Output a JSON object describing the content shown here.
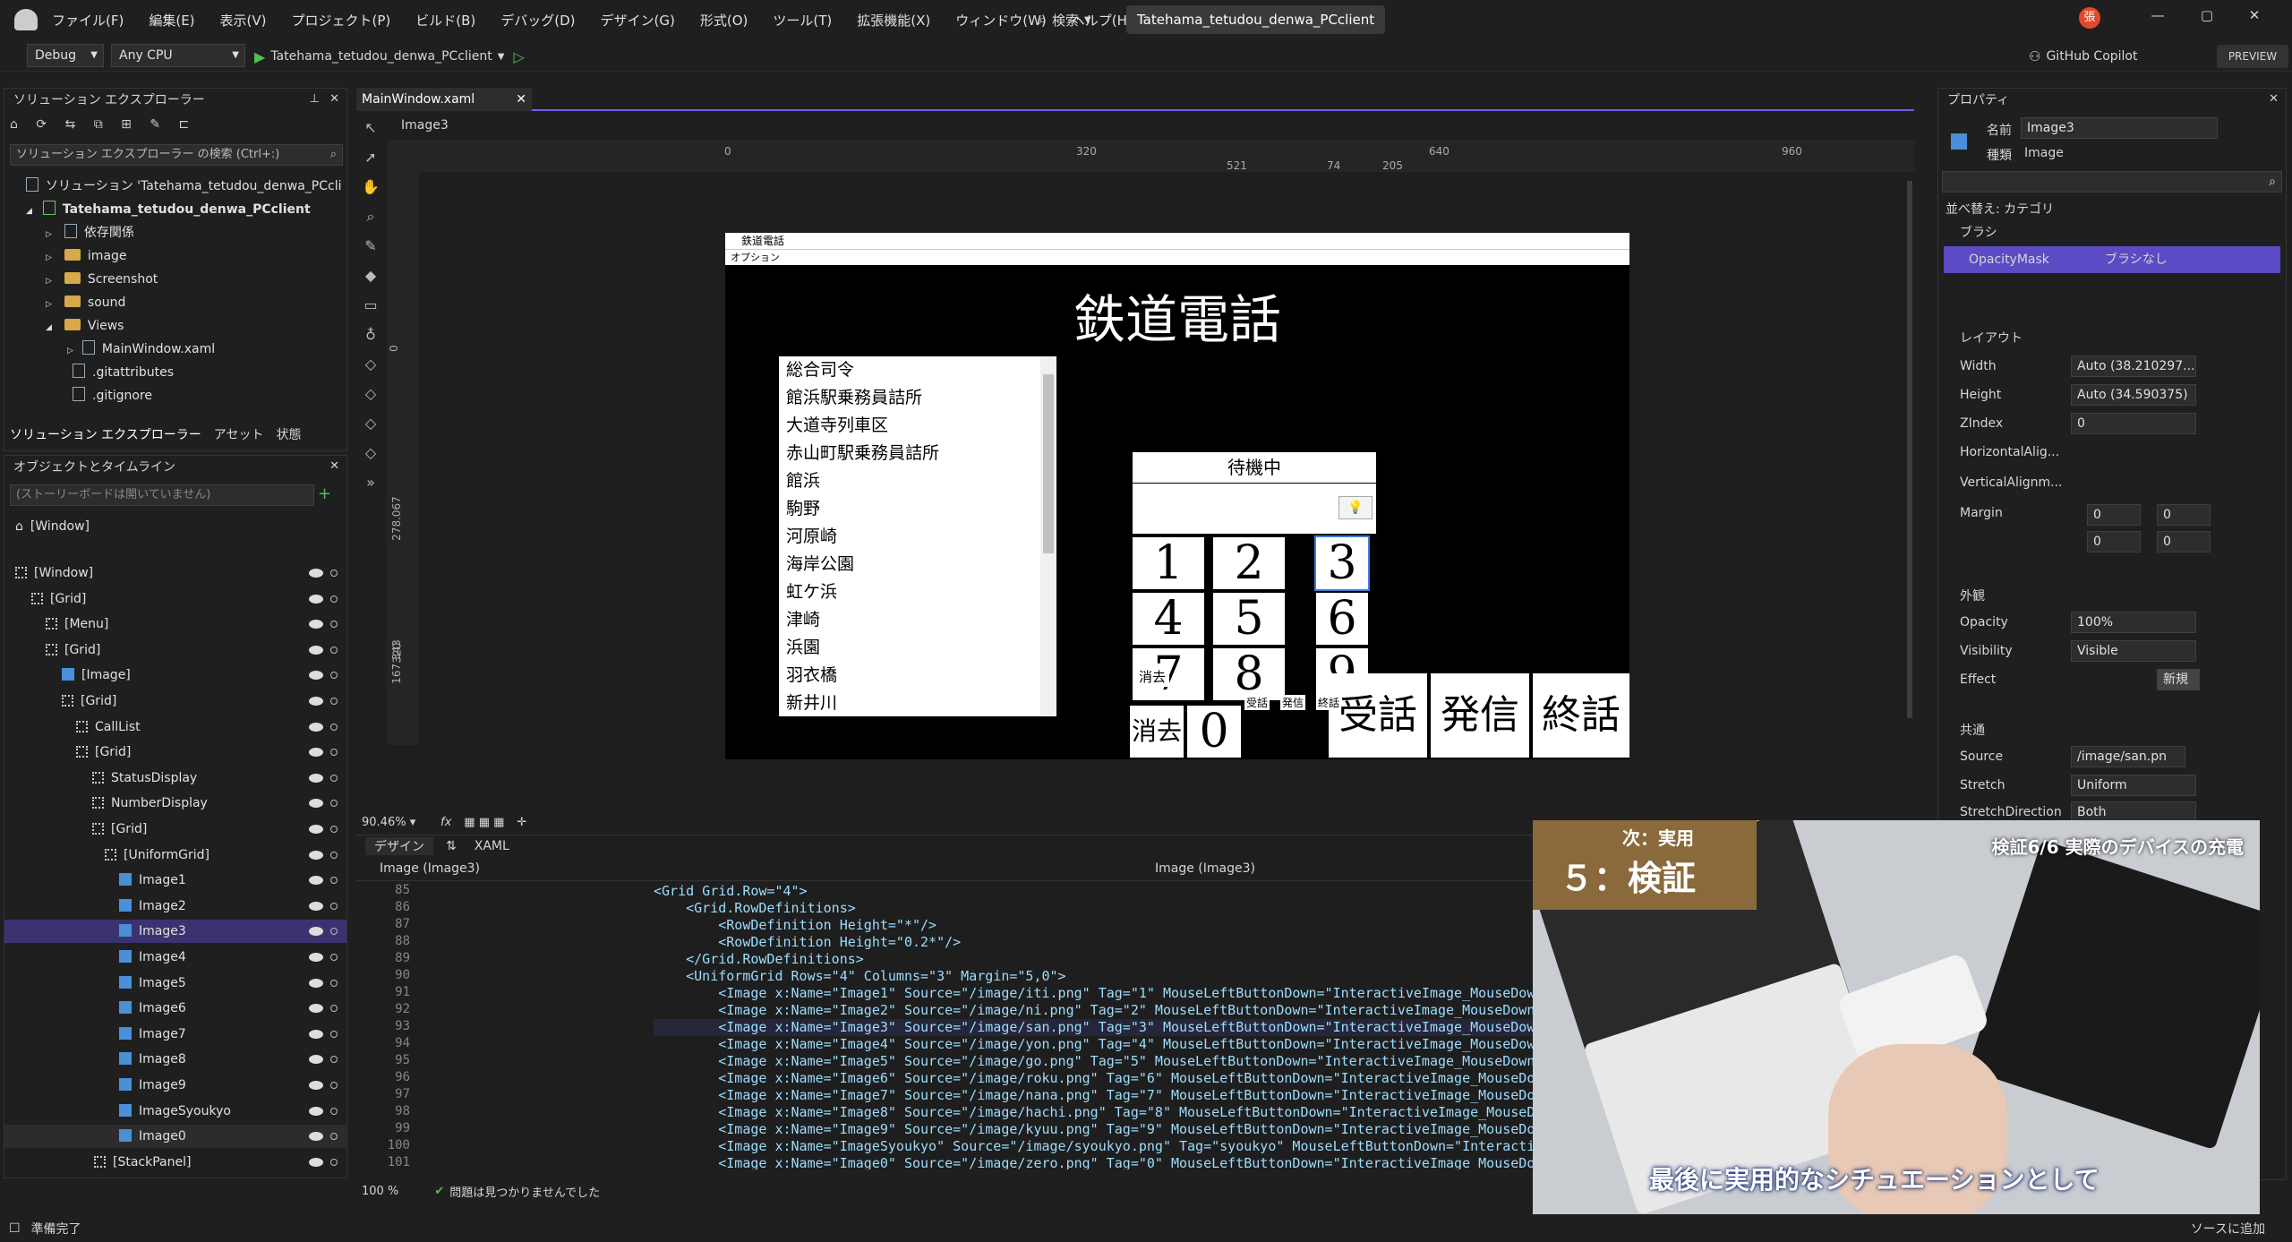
{
  "menubar": {
    "items": [
      "ファイル(F)",
      "編集(E)",
      "表示(V)",
      "プロジェクト(P)",
      "ビルド(B)",
      "デバッグ(D)",
      "デザイン(G)",
      "形式(O)",
      "ツール(T)",
      "拡張機能(X)",
      "ウィンドウ(W)",
      "ヘルプ(H)"
    ],
    "search": "検索",
    "solution_name": "Tatehama_tetudou_denwa_PCclient",
    "avatar": "張",
    "copilot": "GitHub Copilot",
    "preview": "PREVIEW"
  },
  "toolbar": {
    "config": "Debug",
    "platform": "Any CPU",
    "run_target": "Tatehama_tetudou_denwa_PCclient"
  },
  "solution_explorer": {
    "title": "ソリューション エクスプローラー",
    "search_placeholder": "ソリューション エクスプローラー の検索 (Ctrl+:)",
    "solution": "ソリューション 'Tatehama_tetudou_denwa_PCcli",
    "project": "Tatehama_tetudou_denwa_PCclient",
    "items": [
      "依存関係",
      "image",
      "Screenshot",
      "sound",
      "Views",
      "MainWindow.xaml",
      ".gitattributes",
      ".gitignore"
    ],
    "tabs": [
      "ソリューション エクスプローラー",
      "アセット",
      "状態"
    ]
  },
  "objects_timeline": {
    "title": "オブジェクトとタイムライン",
    "storyboard_placeholder": "(ストーリーボードは開いていません)",
    "window_label": "[Window]",
    "nodes": [
      "[Window]",
      "[Grid]",
      "[Menu]",
      "[Grid]",
      "[Image]",
      "[Grid]",
      "CallList",
      "[Grid]",
      "StatusDisplay",
      "NumberDisplay",
      "[Grid]",
      "[UniformGrid]",
      "Image1",
      "Image2",
      "Image3",
      "Image4",
      "Image5",
      "Image6",
      "Image7",
      "Image8",
      "Image9",
      "ImageSyoukyo",
      "Image0",
      "[StackPanel]"
    ]
  },
  "editor": {
    "tab": "MainWindow.xaml",
    "breadcrumb": "Image3",
    "ruler_top": [
      "0",
      "320",
      "640",
      "960"
    ],
    "ruler_sub": [
      "521",
      "74",
      "205"
    ],
    "ruler_left": [
      "0",
      "278.067",
      "320",
      "167.343"
    ],
    "zoom": "90.46%",
    "design_tab": "デザイン",
    "xaml_tab": "XAML",
    "code_scope_left": "Image (Image3)",
    "code_scope_right": "Image (Image3)",
    "status_zoom": "100 %",
    "status_msg": "問題は見つかりませんでした"
  },
  "app": {
    "window_title": "鉄道電話",
    "menu": "オプション",
    "heading": "鉄道電話",
    "status": "待機中",
    "call_list": [
      "総合司令",
      "館浜駅乗務員詰所",
      "大道寺列車区",
      "赤山町駅乗務員詰所",
      "館浜",
      "駒野",
      "河原崎",
      "海岸公園",
      "虹ケ浜",
      "津崎",
      "浜園",
      "羽衣橋",
      "新井川"
    ],
    "keys": [
      "1",
      "2",
      "3",
      "4",
      "5",
      "6",
      "7",
      "8",
      "9",
      "消去",
      "0"
    ],
    "buttons": [
      "受話",
      "発信",
      "終話"
    ],
    "small_labels": [
      "消去",
      "受話",
      "発信",
      "終話"
    ]
  },
  "code": {
    "lines": [
      {
        "n": "85",
        "t": "<Grid Grid.Row=\"4\">"
      },
      {
        "n": "86",
        "t": "    <Grid.RowDefinitions>"
      },
      {
        "n": "87",
        "t": "        <RowDefinition Height=\"*\"/>"
      },
      {
        "n": "88",
        "t": "        <RowDefinition Height=\"0.2*\"/>"
      },
      {
        "n": "89",
        "t": "    </Grid.RowDefinitions>"
      },
      {
        "n": "90",
        "t": "    <UniformGrid Rows=\"4\" Columns=\"3\" Margin=\"5,0\">"
      },
      {
        "n": "91",
        "t": "        <Image x:Name=\"Image1\" Source=\"/image/iti.png\" Tag=\"1\" MouseLeftButtonDown=\"InteractiveImage_MouseDown"
      },
      {
        "n": "92",
        "t": "        <Image x:Name=\"Image2\" Source=\"/image/ni.png\" Tag=\"2\" MouseLeftButtonDown=\"InteractiveImage_MouseDown"
      },
      {
        "n": "93",
        "t": "        <Image x:Name=\"Image3\" Source=\"/image/san.png\" Tag=\"3\" MouseLeftButtonDown=\"InteractiveImage_MouseDown"
      },
      {
        "n": "94",
        "t": "        <Image x:Name=\"Image4\" Source=\"/image/yon.png\" Tag=\"4\" MouseLeftButtonDown=\"InteractiveImage_MouseDown"
      },
      {
        "n": "95",
        "t": "        <Image x:Name=\"Image5\" Source=\"/image/go.png\" Tag=\"5\" MouseLeftButtonDown=\"InteractiveImage_MouseDown"
      },
      {
        "n": "96",
        "t": "        <Image x:Name=\"Image6\" Source=\"/image/roku.png\" Tag=\"6\" MouseLeftButtonDown=\"InteractiveImage_MouseDo"
      },
      {
        "n": "97",
        "t": "        <Image x:Name=\"Image7\" Source=\"/image/nana.png\" Tag=\"7\" MouseLeftButtonDown=\"InteractiveImage_MouseDo"
      },
      {
        "n": "98",
        "t": "        <Image x:Name=\"Image8\" Source=\"/image/hachi.png\" Tag=\"8\" MouseLeftButtonDown=\"InteractiveImage_MouseDo"
      },
      {
        "n": "99",
        "t": "        <Image x:Name=\"Image9\" Source=\"/image/kyuu.png\" Tag=\"9\" MouseLeftButtonDown=\"InteractiveImage_MouseDo"
      },
      {
        "n": "100",
        "t": "        <Image x:Name=\"ImageSyoukyo\" Source=\"/image/syoukyo.png\" Tag=\"syoukyo\" MouseLeftButtonDown=\"Interacti"
      },
      {
        "n": "101",
        "t": "        <Image x:Name=\"Image0\" Source=\"/image/zero.png\" Tag=\"0\" MouseLeftButtonDown=\"InteractiveImage_MouseDo"
      }
    ]
  },
  "properties": {
    "title": "プロパティ",
    "name_label": "名前",
    "name_value": "Image3",
    "type_label": "種類",
    "type_value": "Image",
    "sort": "並べ替え: カテゴリ",
    "brush_section": "ブラシ",
    "opacity_mask": "OpacityMask",
    "no_brush": "ブラシなし",
    "layout_section": "レイアウト",
    "width_label": "Width",
    "width_value": "Auto (38.210297...",
    "height_label": "Height",
    "height_value": "Auto (34.590375)",
    "zindex_label": "ZIndex",
    "zindex_value": "0",
    "halign_label": "HorizontalAlig...",
    "valign_label": "VerticalAlignm...",
    "margin_label": "Margin",
    "margin_values": [
      "0",
      "0",
      "0",
      "0"
    ],
    "appearance_section": "外観",
    "opacity_label": "Opacity",
    "opacity_value": "100%",
    "visibility_label": "Visibility",
    "visibility_value": "Visible",
    "effect_label": "Effect",
    "effect_button": "新規",
    "common_section": "共通",
    "source_label": "Source",
    "source_value": "/image/san.pn",
    "stretch_label": "Stretch",
    "stretch_value": "Uniform",
    "stretchdir_label": "StretchDirection",
    "stretchdir_value": "Both"
  },
  "video_overlay": {
    "next_label": "次：実用",
    "chapter": "５：検証",
    "header": "検証6/6 実際のデバイスの充電",
    "subtitle": "最後に実用的なシチュエーションとして"
  },
  "statusbar": {
    "ready": "準備完了",
    "right": "ソースに追加"
  }
}
